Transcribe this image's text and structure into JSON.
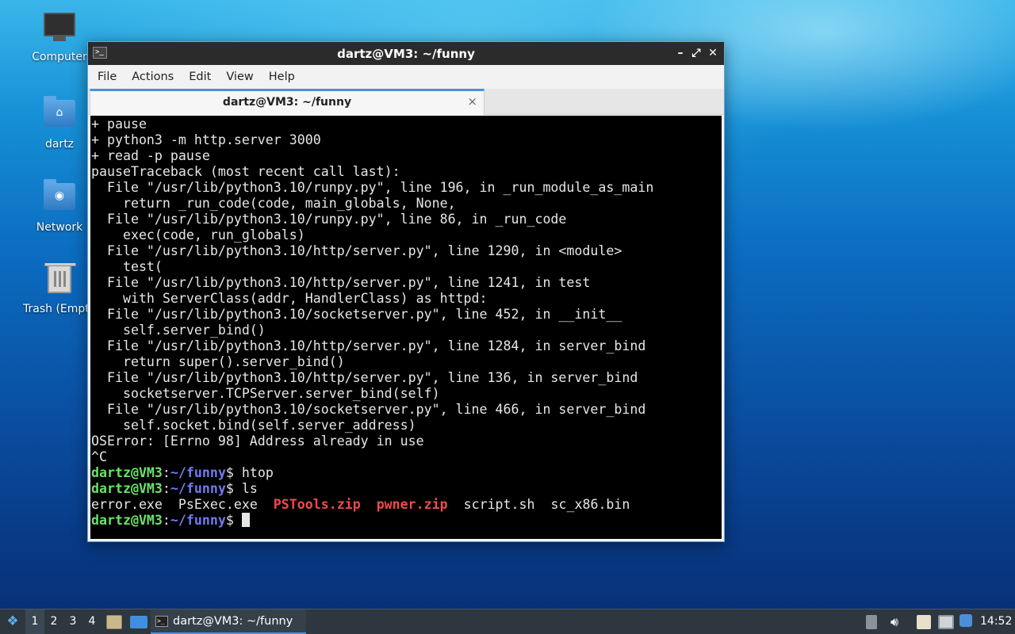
{
  "desktop": {
    "icons": [
      {
        "label": "Computer",
        "icon": "computer-icon"
      },
      {
        "label": "dartz",
        "icon": "home-folder-icon"
      },
      {
        "label": "Network",
        "icon": "network-folder-icon"
      },
      {
        "label": "Trash (Empty)",
        "icon": "trash-icon"
      }
    ]
  },
  "window": {
    "title": "dartz@VM3: ~/funny",
    "menu": [
      "File",
      "Actions",
      "Edit",
      "View",
      "Help"
    ],
    "tab": {
      "label": "dartz@VM3: ~/funny",
      "close": "×"
    },
    "controls": {
      "minimize": "–",
      "maximize": "⤢",
      "close": "✕"
    }
  },
  "terminal": {
    "lines": [
      "+ pause",
      "+ python3 -m http.server 3000",
      "+ read -p pause",
      "pauseTraceback (most recent call last):",
      "  File \"/usr/lib/python3.10/runpy.py\", line 196, in _run_module_as_main",
      "    return _run_code(code, main_globals, None,",
      "  File \"/usr/lib/python3.10/runpy.py\", line 86, in _run_code",
      "    exec(code, run_globals)",
      "  File \"/usr/lib/python3.10/http/server.py\", line 1290, in <module>",
      "    test(",
      "  File \"/usr/lib/python3.10/http/server.py\", line 1241, in test",
      "    with ServerClass(addr, HandlerClass) as httpd:",
      "  File \"/usr/lib/python3.10/socketserver.py\", line 452, in __init__",
      "    self.server_bind()",
      "  File \"/usr/lib/python3.10/http/server.py\", line 1284, in server_bind",
      "    return super().server_bind()",
      "  File \"/usr/lib/python3.10/http/server.py\", line 136, in server_bind",
      "    socketserver.TCPServer.server_bind(self)",
      "  File \"/usr/lib/python3.10/socketserver.py\", line 466, in server_bind",
      "    self.socket.bind(self.server_address)",
      "OSError: [Errno 98] Address already in use",
      "^C"
    ],
    "prompt_user": "dartz@VM3",
    "prompt_sep": ":",
    "prompt_path": "~/funny",
    "prompt_sym": "$",
    "commands": [
      " htop",
      " ls"
    ],
    "ls_files": [
      {
        "name": "error.exe",
        "highlight": false
      },
      {
        "name": "PsExec.exe",
        "highlight": false
      },
      {
        "name": "PSTools.zip",
        "highlight": true
      },
      {
        "name": "pwner.zip",
        "highlight": true
      },
      {
        "name": "script.sh",
        "highlight": false
      },
      {
        "name": "sc_x86.bin",
        "highlight": false
      }
    ]
  },
  "taskbar": {
    "workspaces": [
      "1",
      "2",
      "3",
      "4"
    ],
    "active_task": "dartz@VM3: ~/funny",
    "clock": "14:52"
  }
}
